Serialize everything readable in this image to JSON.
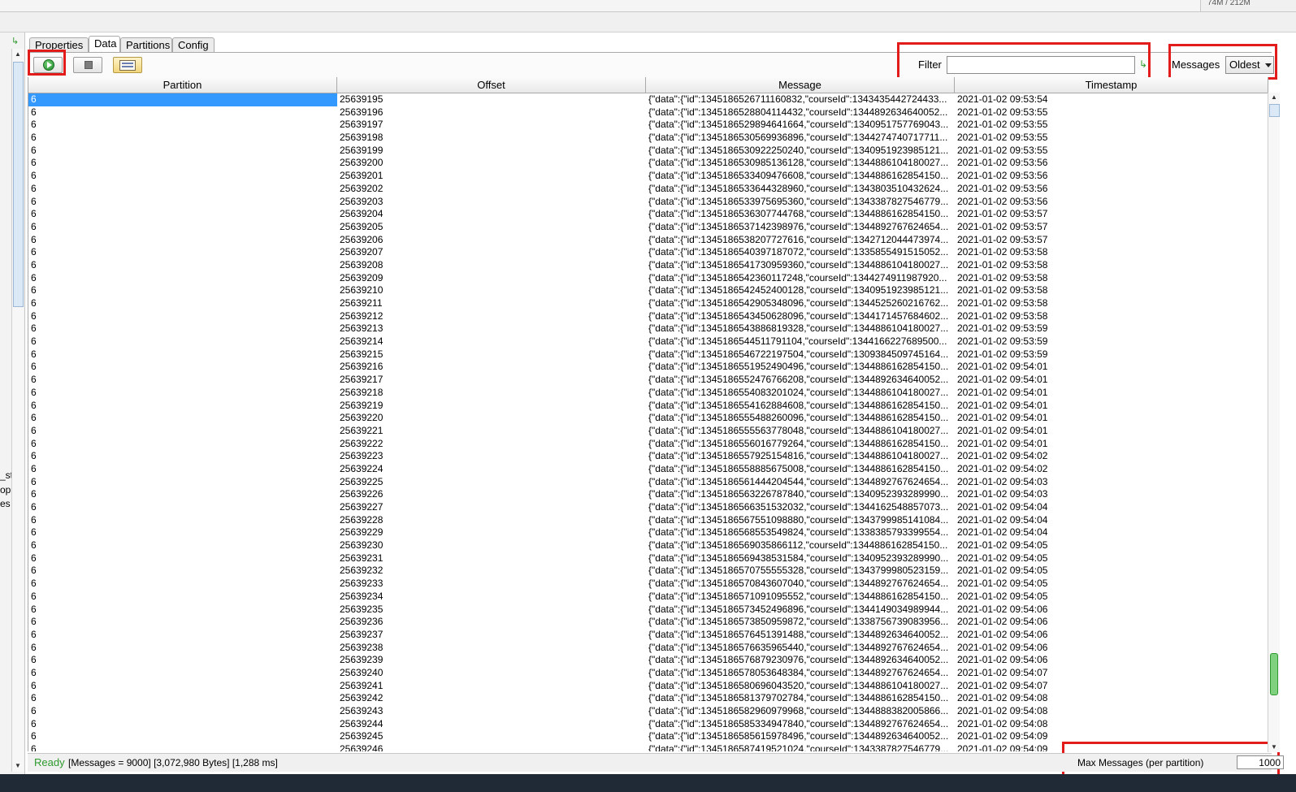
{
  "top": {
    "memory_text": "74M / 212M"
  },
  "left_panel": {
    "fragments": [
      "_st",
      "opi",
      "es"
    ]
  },
  "tabs": [
    {
      "label": "Properties"
    },
    {
      "label": "Data"
    },
    {
      "label": "Partitions"
    },
    {
      "label": "Config"
    }
  ],
  "toolbar": {
    "filter_label": "Filter",
    "filter_value": "",
    "messages_label": "Messages",
    "messages_selected": "Oldest"
  },
  "table": {
    "columns": [
      "Partition",
      "Offset",
      "Message",
      "Timestamp"
    ],
    "rows": [
      {
        "partition": "6",
        "offset": "25639195",
        "message": "{\"data\":{\"id\":1345186526711160832,\"courseId\":1343435442724433...",
        "timestamp": "2021-01-02 09:53:54"
      },
      {
        "partition": "6",
        "offset": "25639196",
        "message": "{\"data\":{\"id\":1345186528804114432,\"courseId\":1344892634640052...",
        "timestamp": "2021-01-02 09:53:55"
      },
      {
        "partition": "6",
        "offset": "25639197",
        "message": "{\"data\":{\"id\":1345186529894641664,\"courseId\":1340951757769043...",
        "timestamp": "2021-01-02 09:53:55"
      },
      {
        "partition": "6",
        "offset": "25639198",
        "message": "{\"data\":{\"id\":1345186530569936896,\"courseId\":1344274740717711...",
        "timestamp": "2021-01-02 09:53:55"
      },
      {
        "partition": "6",
        "offset": "25639199",
        "message": "{\"data\":{\"id\":1345186530922250240,\"courseId\":1340951923985121...",
        "timestamp": "2021-01-02 09:53:55"
      },
      {
        "partition": "6",
        "offset": "25639200",
        "message": "{\"data\":{\"id\":1345186530985136128,\"courseId\":1344886104180027...",
        "timestamp": "2021-01-02 09:53:56"
      },
      {
        "partition": "6",
        "offset": "25639201",
        "message": "{\"data\":{\"id\":1345186533409476608,\"courseId\":1344886162854150...",
        "timestamp": "2021-01-02 09:53:56"
      },
      {
        "partition": "6",
        "offset": "25639202",
        "message": "{\"data\":{\"id\":1345186533644328960,\"courseId\":1343803510432624...",
        "timestamp": "2021-01-02 09:53:56"
      },
      {
        "partition": "6",
        "offset": "25639203",
        "message": "{\"data\":{\"id\":1345186533975695360,\"courseId\":1343387827546779...",
        "timestamp": "2021-01-02 09:53:56"
      },
      {
        "partition": "6",
        "offset": "25639204",
        "message": "{\"data\":{\"id\":1345186536307744768,\"courseId\":1344886162854150...",
        "timestamp": "2021-01-02 09:53:57"
      },
      {
        "partition": "6",
        "offset": "25639205",
        "message": "{\"data\":{\"id\":1345186537142398976,\"courseId\":1344892767624654...",
        "timestamp": "2021-01-02 09:53:57"
      },
      {
        "partition": "6",
        "offset": "25639206",
        "message": "{\"data\":{\"id\":1345186538207727616,\"courseId\":1342712044473974...",
        "timestamp": "2021-01-02 09:53:57"
      },
      {
        "partition": "6",
        "offset": "25639207",
        "message": "{\"data\":{\"id\":1345186540397187072,\"courseId\":1335855491515052...",
        "timestamp": "2021-01-02 09:53:58"
      },
      {
        "partition": "6",
        "offset": "25639208",
        "message": "{\"data\":{\"id\":1345186541730959360,\"courseId\":1344886104180027...",
        "timestamp": "2021-01-02 09:53:58"
      },
      {
        "partition": "6",
        "offset": "25639209",
        "message": "{\"data\":{\"id\":1345186542360117248,\"courseId\":1344274911987920...",
        "timestamp": "2021-01-02 09:53:58"
      },
      {
        "partition": "6",
        "offset": "25639210",
        "message": "{\"data\":{\"id\":1345186542452400128,\"courseId\":1340951923985121...",
        "timestamp": "2021-01-02 09:53:58"
      },
      {
        "partition": "6",
        "offset": "25639211",
        "message": "{\"data\":{\"id\":1345186542905348096,\"courseId\":1344525260216762...",
        "timestamp": "2021-01-02 09:53:58"
      },
      {
        "partition": "6",
        "offset": "25639212",
        "message": "{\"data\":{\"id\":1345186543450628096,\"courseId\":1344171457684602...",
        "timestamp": "2021-01-02 09:53:58"
      },
      {
        "partition": "6",
        "offset": "25639213",
        "message": "{\"data\":{\"id\":1345186543886819328,\"courseId\":1344886104180027...",
        "timestamp": "2021-01-02 09:53:59"
      },
      {
        "partition": "6",
        "offset": "25639214",
        "message": "{\"data\":{\"id\":1345186544511791104,\"courseId\":1344166227689500...",
        "timestamp": "2021-01-02 09:53:59"
      },
      {
        "partition": "6",
        "offset": "25639215",
        "message": "{\"data\":{\"id\":1345186546722197504,\"courseId\":1309384509745164...",
        "timestamp": "2021-01-02 09:53:59"
      },
      {
        "partition": "6",
        "offset": "25639216",
        "message": "{\"data\":{\"id\":1345186551952490496,\"courseId\":1344886162854150...",
        "timestamp": "2021-01-02 09:54:01"
      },
      {
        "partition": "6",
        "offset": "25639217",
        "message": "{\"data\":{\"id\":1345186552476766208,\"courseId\":1344892634640052...",
        "timestamp": "2021-01-02 09:54:01"
      },
      {
        "partition": "6",
        "offset": "25639218",
        "message": "{\"data\":{\"id\":1345186554083201024,\"courseId\":1344886104180027...",
        "timestamp": "2021-01-02 09:54:01"
      },
      {
        "partition": "6",
        "offset": "25639219",
        "message": "{\"data\":{\"id\":1345186554162884608,\"courseId\":1344886162854150...",
        "timestamp": "2021-01-02 09:54:01"
      },
      {
        "partition": "6",
        "offset": "25639220",
        "message": "{\"data\":{\"id\":1345186555488260096,\"courseId\":1344886162854150...",
        "timestamp": "2021-01-02 09:54:01"
      },
      {
        "partition": "6",
        "offset": "25639221",
        "message": "{\"data\":{\"id\":1345186555563778048,\"courseId\":1344886104180027...",
        "timestamp": "2021-01-02 09:54:01"
      },
      {
        "partition": "6",
        "offset": "25639222",
        "message": "{\"data\":{\"id\":1345186556016779264,\"courseId\":1344886162854150...",
        "timestamp": "2021-01-02 09:54:01"
      },
      {
        "partition": "6",
        "offset": "25639223",
        "message": "{\"data\":{\"id\":1345186557925154816,\"courseId\":1344886104180027...",
        "timestamp": "2021-01-02 09:54:02"
      },
      {
        "partition": "6",
        "offset": "25639224",
        "message": "{\"data\":{\"id\":1345186558885675008,\"courseId\":1344886162854150...",
        "timestamp": "2021-01-02 09:54:02"
      },
      {
        "partition": "6",
        "offset": "25639225",
        "message": "{\"data\":{\"id\":1345186561444204544,\"courseId\":1344892767624654...",
        "timestamp": "2021-01-02 09:54:03"
      },
      {
        "partition": "6",
        "offset": "25639226",
        "message": "{\"data\":{\"id\":1345186563226787840,\"courseId\":1340952393289990...",
        "timestamp": "2021-01-02 09:54:03"
      },
      {
        "partition": "6",
        "offset": "25639227",
        "message": "{\"data\":{\"id\":1345186566351532032,\"courseId\":1344162548857073...",
        "timestamp": "2021-01-02 09:54:04"
      },
      {
        "partition": "6",
        "offset": "25639228",
        "message": "{\"data\":{\"id\":1345186567551098880,\"courseId\":1343799985141084...",
        "timestamp": "2021-01-02 09:54:04"
      },
      {
        "partition": "6",
        "offset": "25639229",
        "message": "{\"data\":{\"id\":1345186568553549824,\"courseId\":1338385793399554...",
        "timestamp": "2021-01-02 09:54:04"
      },
      {
        "partition": "6",
        "offset": "25639230",
        "message": "{\"data\":{\"id\":1345186569035866112,\"courseId\":1344886162854150...",
        "timestamp": "2021-01-02 09:54:05"
      },
      {
        "partition": "6",
        "offset": "25639231",
        "message": "{\"data\":{\"id\":1345186569438531584,\"courseId\":1340952393289990...",
        "timestamp": "2021-01-02 09:54:05"
      },
      {
        "partition": "6",
        "offset": "25639232",
        "message": "{\"data\":{\"id\":1345186570755555328,\"courseId\":1343799980523159...",
        "timestamp": "2021-01-02 09:54:05"
      },
      {
        "partition": "6",
        "offset": "25639233",
        "message": "{\"data\":{\"id\":1345186570843607040,\"courseId\":1344892767624654...",
        "timestamp": "2021-01-02 09:54:05"
      },
      {
        "partition": "6",
        "offset": "25639234",
        "message": "{\"data\":{\"id\":1345186571091095552,\"courseId\":1344886162854150...",
        "timestamp": "2021-01-02 09:54:05"
      },
      {
        "partition": "6",
        "offset": "25639235",
        "message": "{\"data\":{\"id\":1345186573452496896,\"courseId\":1344149034989944...",
        "timestamp": "2021-01-02 09:54:06"
      },
      {
        "partition": "6",
        "offset": "25639236",
        "message": "{\"data\":{\"id\":1345186573850959872,\"courseId\":1338756739083956...",
        "timestamp": "2021-01-02 09:54:06"
      },
      {
        "partition": "6",
        "offset": "25639237",
        "message": "{\"data\":{\"id\":1345186576451391488,\"courseId\":1344892634640052...",
        "timestamp": "2021-01-02 09:54:06"
      },
      {
        "partition": "6",
        "offset": "25639238",
        "message": "{\"data\":{\"id\":1345186576635965440,\"courseId\":1344892767624654...",
        "timestamp": "2021-01-02 09:54:06"
      },
      {
        "partition": "6",
        "offset": "25639239",
        "message": "{\"data\":{\"id\":1345186576879230976,\"courseId\":1344892634640052...",
        "timestamp": "2021-01-02 09:54:06"
      },
      {
        "partition": "6",
        "offset": "25639240",
        "message": "{\"data\":{\"id\":1345186578053648384,\"courseId\":1344892767624654...",
        "timestamp": "2021-01-02 09:54:07"
      },
      {
        "partition": "6",
        "offset": "25639241",
        "message": "{\"data\":{\"id\":1345186580696043520,\"courseId\":1344886104180027...",
        "timestamp": "2021-01-02 09:54:07"
      },
      {
        "partition": "6",
        "offset": "25639242",
        "message": "{\"data\":{\"id\":1345186581379702784,\"courseId\":1344886162854150...",
        "timestamp": "2021-01-02 09:54:08"
      },
      {
        "partition": "6",
        "offset": "25639243",
        "message": "{\"data\":{\"id\":1345186582960979968,\"courseId\":1344888382005866...",
        "timestamp": "2021-01-02 09:54:08"
      },
      {
        "partition": "6",
        "offset": "25639244",
        "message": "{\"data\":{\"id\":1345186585334947840,\"courseId\":1344892767624654...",
        "timestamp": "2021-01-02 09:54:08"
      },
      {
        "partition": "6",
        "offset": "25639245",
        "message": "{\"data\":{\"id\":1345186585615978496,\"courseId\":1344892634640052...",
        "timestamp": "2021-01-02 09:54:09"
      },
      {
        "partition": "6",
        "offset": "25639246",
        "message": "{\"data\":{\"id\":1345186587419521024,\"courseId\":1343387827546779...",
        "timestamp": "2021-01-02 09:54:09"
      }
    ]
  },
  "status": {
    "ready": "Ready",
    "messages": "[Messages = 9000]",
    "bytes": "[3,072,980 Bytes]",
    "time": "[1,288 ms]",
    "max_messages_label": "Max Messages (per partition)",
    "max_messages_value": "1000"
  },
  "colors": {
    "highlight": "#e21b1b",
    "selection": "#3399ff",
    "ready": "#2e9a2e"
  }
}
